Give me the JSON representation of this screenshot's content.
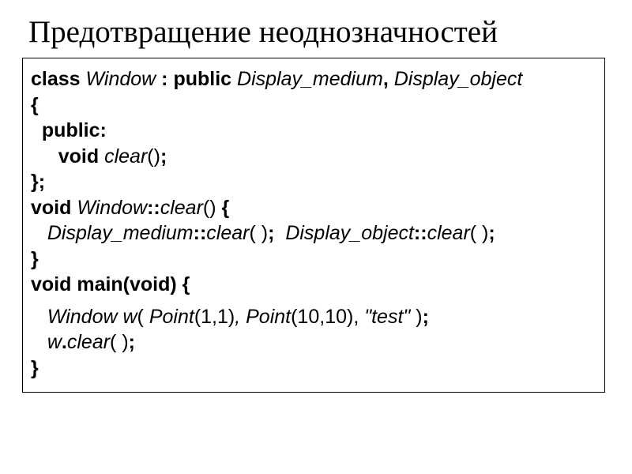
{
  "title": "Предотвращение неоднозначностей",
  "code": {
    "l1_kw_class": "class",
    "l1_id_window": "Window",
    "l1_kw_public": "public",
    "l1_id_dm": "Display_medium",
    "l1_id_do": "Display_object",
    "l2_brace": "{",
    "l3_public": "public:",
    "l4_kw_void": "void",
    "l4_id_clear": "clear",
    "l5_brace_semi": "};",
    "l6_kw_void": "void",
    "l6_id_window": "Window",
    "l6_id_clear": "clear",
    "l7_id_dm": "Display_medium",
    "l7_id_clear1": "clear",
    "l7_id_do": "Display_object",
    "l7_id_clear2": "clear",
    "l8_brace": "}",
    "l9_main": "void main(void) {",
    "l10_window": "Window w",
    "l10_point1": "Point",
    "l10_args1": "(1,1)",
    "l10_point2": "Point",
    "l10_args2": "(10,10)",
    "l10_str": "\"test\"",
    "l11_w": "w",
    "l11_clear": "clear",
    "l12_brace": "}"
  }
}
